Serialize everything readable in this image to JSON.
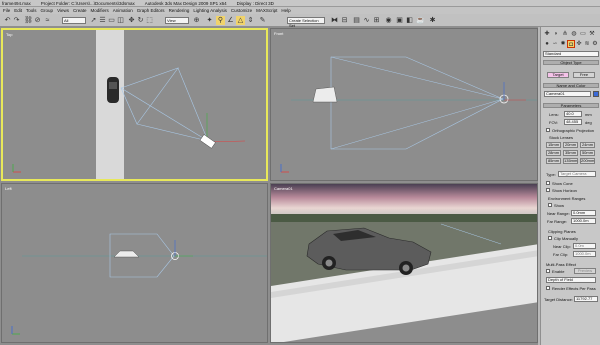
{
  "titlebar": {
    "file": "frame494.max",
    "project": "Project Folder: C:\\Users\\...\\Documents\\3dsmax",
    "app": "Autodesk 3ds Max Design 2009 SP1 x64",
    "display": "Display : Direct 3D"
  },
  "menu": [
    "File",
    "Edit",
    "Tools",
    "Group",
    "Views",
    "Create",
    "Modifiers",
    "Animation",
    "Graph Editors",
    "Rendering",
    "Lighting Analysis",
    "Customize",
    "MAXScript",
    "Help"
  ],
  "toolbar": {
    "selection_filter": "All",
    "ref_coord": "View",
    "named_sets": "Create Selection Set"
  },
  "viewports": {
    "top_left": "Top",
    "top_right": "Front",
    "bottom_left": "Left",
    "bottom_right": "Camera01"
  },
  "command_panel": {
    "category": "Standard",
    "object_type_header": "Object Type",
    "btn_target": "Target",
    "btn_free": "Free",
    "name_color_header": "Name and Color",
    "camera_name": "Camera01",
    "parameters_header": "Parameters",
    "lens_label": "Lens:",
    "lens_value": "40.0",
    "lens_unit": "mm",
    "fov_label": "FOV:",
    "fov_value": "48.455",
    "fov_unit": "deg",
    "ortho_label": "Orthographic Projection",
    "stock_lenses_header": "Stock Lenses",
    "stock_lenses": [
      "15mm",
      "20mm",
      "24mm",
      "28mm",
      "35mm",
      "50mm",
      "85mm",
      "135mm",
      "200mm"
    ],
    "type_label": "Type:",
    "type_value": "Target Camera",
    "show_cone": "Show Cone",
    "show_horizon": "Show Horizon",
    "env_ranges_header": "Environment Ranges",
    "env_show": "Show",
    "near_range_label": "Near Range:",
    "near_range_value": "0.0mm",
    "far_range_label": "Far Range:",
    "far_range_value": "1000.0m",
    "clipping_header": "Clipping Planes",
    "clip_manually": "Clip Manually",
    "near_clip_label": "Near Clip:",
    "near_clip_value": "0.0m",
    "far_clip_label": "Far Clip:",
    "far_clip_value": "1000.0m",
    "multipass_header": "Multi-Pass Effect",
    "enable_label": "Enable",
    "preview_btn": "Preview",
    "dof_value": "Depth of Field",
    "render_effects": "Render Effects Per Pass",
    "target_distance_label": "Target Distance:",
    "target_distance_value": "11792.77"
  },
  "colors": {
    "viewport_bg": "#8e8e8e",
    "active_border": "#e8e85a",
    "camera_cone": "#a9c8e6",
    "highlight_button": "#f5c3e9"
  }
}
